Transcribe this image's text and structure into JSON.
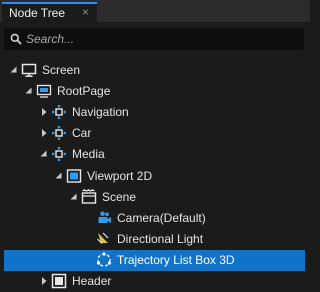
{
  "panel": {
    "title": "Node Tree",
    "close_glyph": "×"
  },
  "search": {
    "placeholder": "Search...",
    "value": "",
    "icon": "search-icon"
  },
  "tree": {
    "nodes": [
      {
        "label": "Screen",
        "depth": 0,
        "expanded": true,
        "icon": "monitor-icon"
      },
      {
        "label": "RootPage",
        "depth": 1,
        "expanded": true,
        "icon": "page-icon"
      },
      {
        "label": "Navigation",
        "depth": 2,
        "expanded": false,
        "icon": "node-icon"
      },
      {
        "label": "Car",
        "depth": 2,
        "expanded": false,
        "icon": "node-icon"
      },
      {
        "label": "Media",
        "depth": 2,
        "expanded": true,
        "icon": "node-icon"
      },
      {
        "label": "Viewport 2D",
        "depth": 3,
        "expanded": true,
        "icon": "viewport-icon"
      },
      {
        "label": "Scene",
        "depth": 4,
        "expanded": true,
        "icon": "scene-icon"
      },
      {
        "label": "Camera",
        "suffix": "(Default)",
        "depth": 5,
        "icon": "camera-icon"
      },
      {
        "label": "Directional Light",
        "depth": 5,
        "icon": "light-icon"
      },
      {
        "label": "Trajectory List Box 3D",
        "depth": 5,
        "icon": "trajectory-icon",
        "selected": true
      },
      {
        "label": "Header",
        "depth": 2,
        "expanded": false,
        "icon": "header-icon"
      }
    ]
  },
  "colors": {
    "selection": "#1173c7",
    "accent": "#1e90ff",
    "background": "#1b1b1b"
  }
}
